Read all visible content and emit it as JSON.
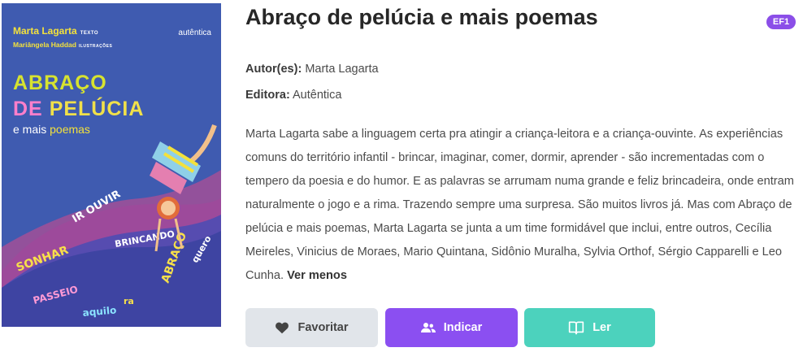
{
  "cover": {
    "author": "Marta Lagarta",
    "author_role": "TEXTO",
    "illustrator": "Mariângela Haddad",
    "illustrator_role": "ILUSTRAÇÕES",
    "publisher": "autêntica",
    "title_line1": "ABRAÇO",
    "title_line2_a": "DE",
    "title_line2_b": "PELÚCIA",
    "title_line3_a": "e mais",
    "title_line3_b": "poemas"
  },
  "book": {
    "title": "Abraço de pelúcia e mais poemas",
    "badge": "EF1",
    "author_label": "Autor(es):",
    "author": "Marta Lagarta",
    "publisher_label": "Editora:",
    "publisher": "Autêntica",
    "description": "Marta Lagarta sabe a linguagem certa pra atingir a criança-leitora e a criança-ouvinte. As experiências comuns do território infantil - brincar, imaginar, comer, dormir, aprender - são incrementadas com o tempero da poesia e do humor. E as palavras se arrumam numa grande e feliz brincadeira, onde entram naturalmente o jogo e a rima. Trazendo sempre uma surpresa. São muitos livros já. Mas com Abraço de pelúcia e mais poemas, Marta Lagarta se junta a um time formidável que inclui, entre outros, Cecília Meireles, Vinicius de Moraes, Mario Quintana, Sidônio Muralha, Sylvia Orthof, Sérgio Capparelli e Leo Cunha.",
    "see_less": "Ver menos"
  },
  "actions": {
    "favorite": "Favoritar",
    "recommend": "Indicar",
    "read": "Ler"
  },
  "colors": {
    "badge": "#8b4ee8",
    "favorite_bg": "#e1e5ea",
    "recommend_bg": "#8b4ff1",
    "read_bg": "#4cd2bd"
  }
}
